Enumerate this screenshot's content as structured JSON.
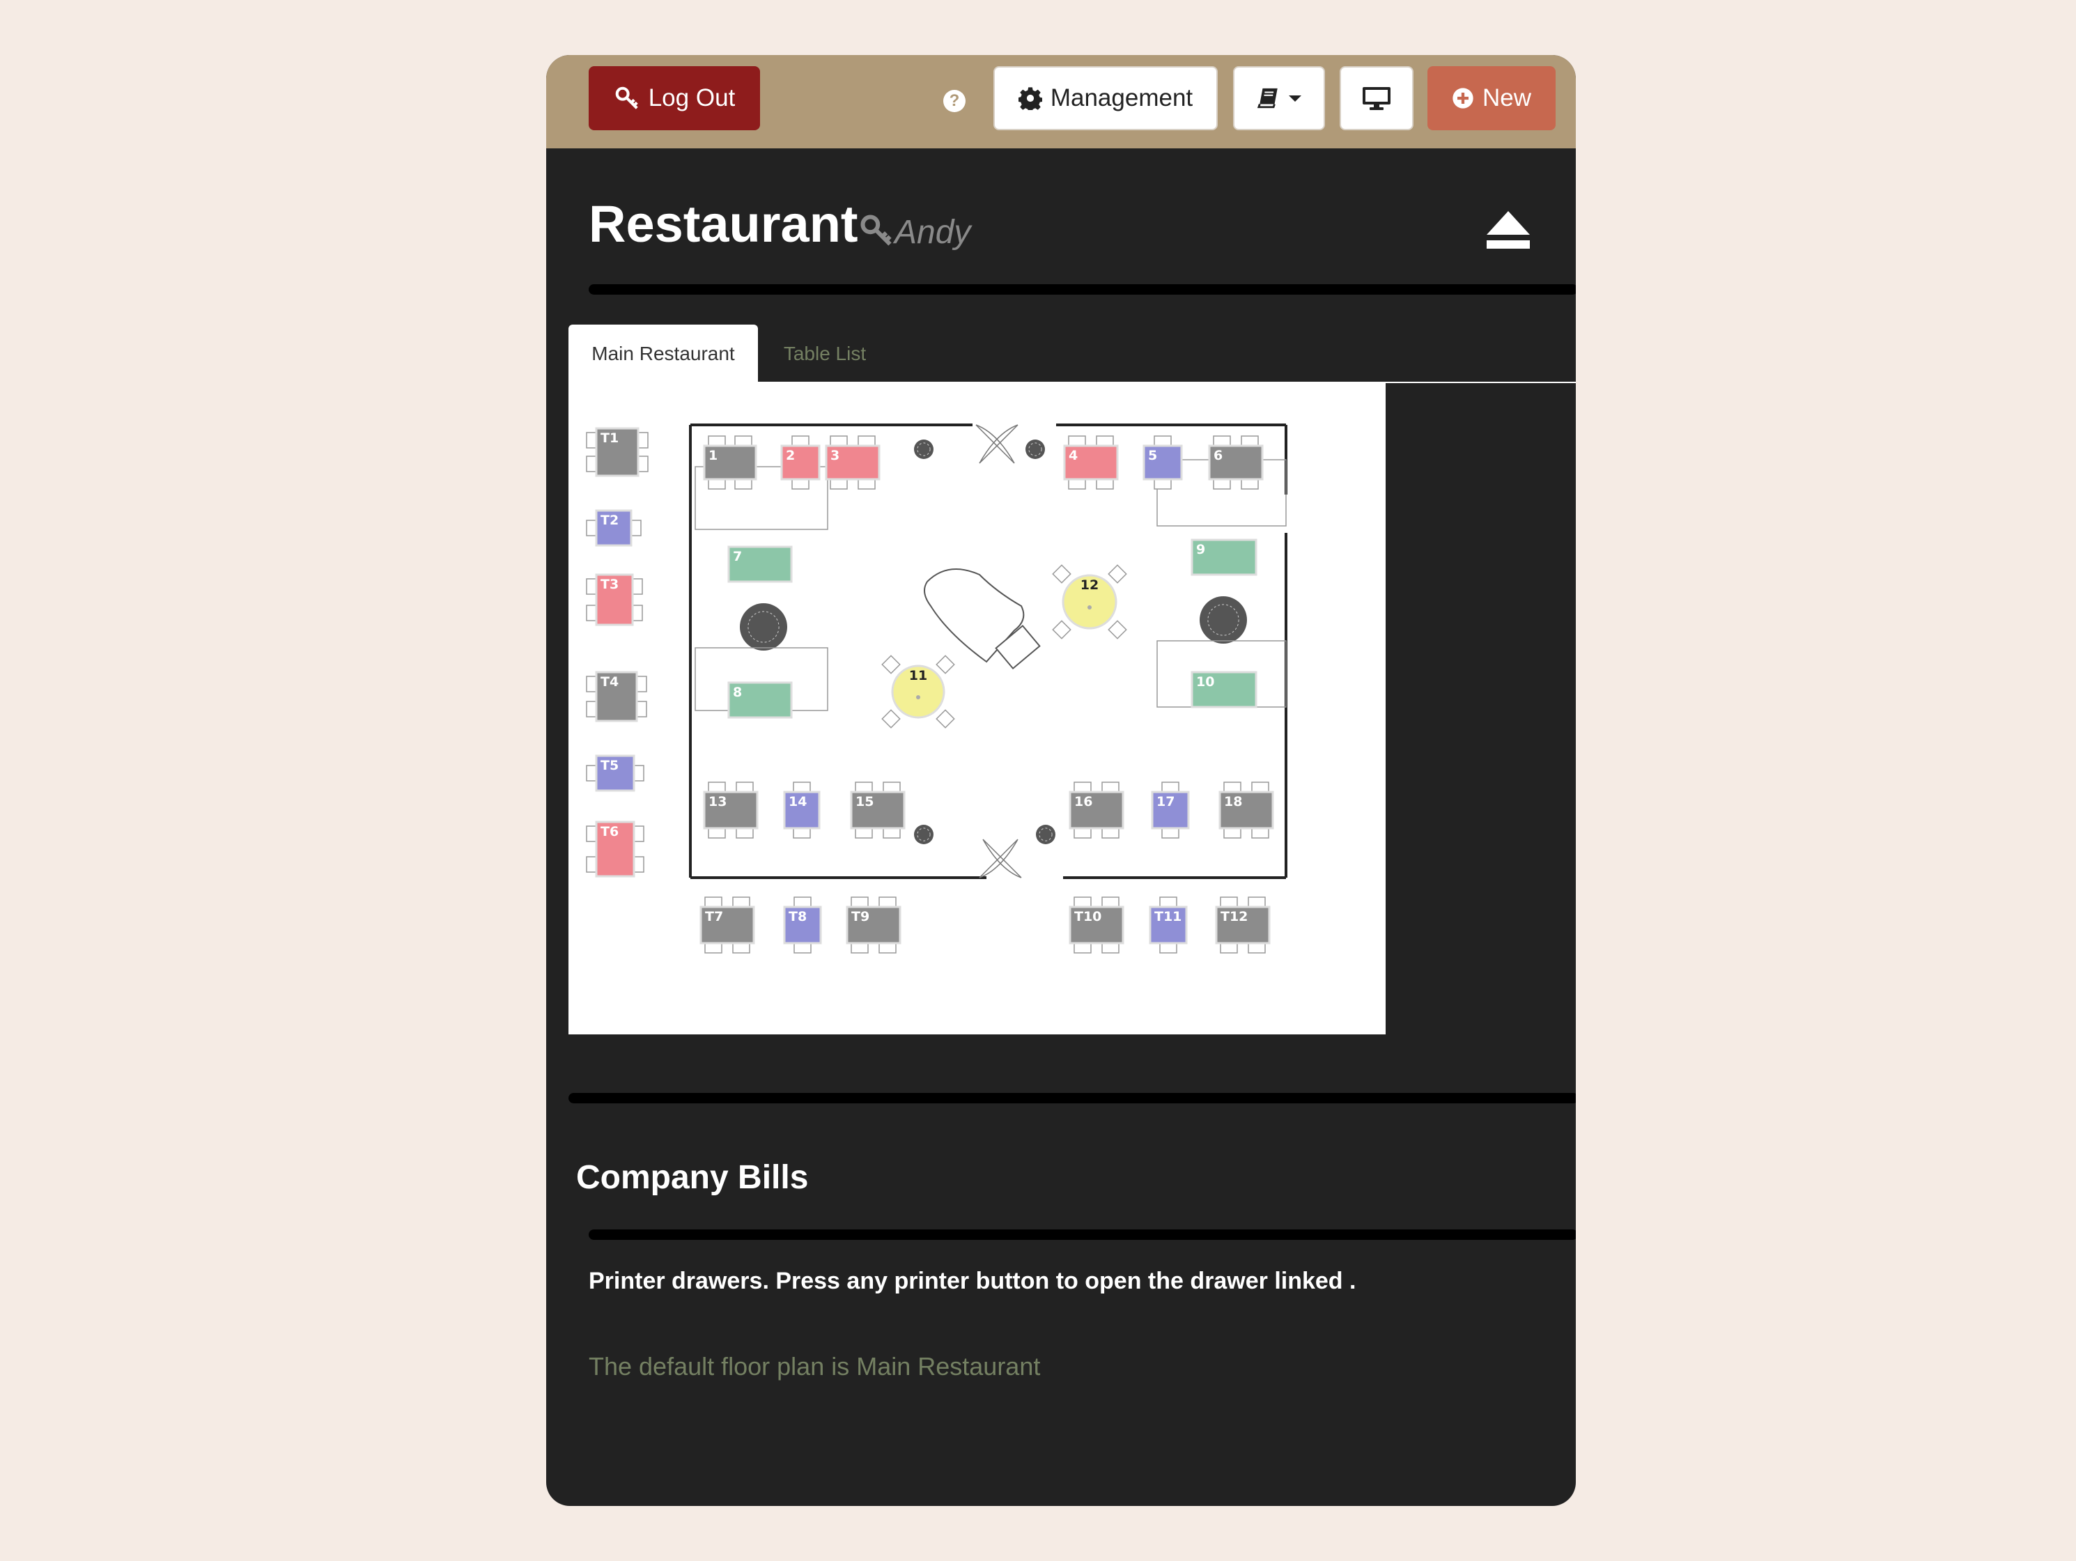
{
  "toolbar": {
    "logout_label": "Log Out",
    "help_label": "?",
    "management_label": "Management",
    "new_label": "New",
    "bar_color": "#b09a78",
    "logout_color": "#8e1c1c",
    "new_color": "#c7684f"
  },
  "header": {
    "title": "Restaurant",
    "user": "Andy"
  },
  "tabs": [
    {
      "label": "Main Restaurant",
      "active": true
    },
    {
      "label": "Table List",
      "active": false
    }
  ],
  "floor_plan": {
    "status_colors": {
      "grey": "#8c8c8c",
      "red": "#f0868f",
      "blue": "#8f8fd6",
      "green": "#8cc6a8",
      "yellow": "#f3f095"
    },
    "tables": [
      {
        "label": "T1",
        "color": "grey"
      },
      {
        "label": "T2",
        "color": "blue"
      },
      {
        "label": "T3",
        "color": "red"
      },
      {
        "label": "T4",
        "color": "grey"
      },
      {
        "label": "T5",
        "color": "blue"
      },
      {
        "label": "T6",
        "color": "red"
      },
      {
        "label": "1",
        "color": "grey"
      },
      {
        "label": "2",
        "color": "red"
      },
      {
        "label": "3",
        "color": "red"
      },
      {
        "label": "4",
        "color": "red"
      },
      {
        "label": "5",
        "color": "blue"
      },
      {
        "label": "6",
        "color": "grey"
      },
      {
        "label": "7",
        "color": "green"
      },
      {
        "label": "8",
        "color": "green"
      },
      {
        "label": "9",
        "color": "green"
      },
      {
        "label": "10",
        "color": "green"
      },
      {
        "label": "11",
        "color": "yellow"
      },
      {
        "label": "12",
        "color": "yellow"
      },
      {
        "label": "13",
        "color": "grey"
      },
      {
        "label": "14",
        "color": "blue"
      },
      {
        "label": "15",
        "color": "grey"
      },
      {
        "label": "16",
        "color": "grey"
      },
      {
        "label": "17",
        "color": "blue"
      },
      {
        "label": "18",
        "color": "grey"
      },
      {
        "label": "T7",
        "color": "grey"
      },
      {
        "label": "T8",
        "color": "blue"
      },
      {
        "label": "T9",
        "color": "grey"
      },
      {
        "label": "T10",
        "color": "grey"
      },
      {
        "label": "T11",
        "color": "blue"
      },
      {
        "label": "T12",
        "color": "grey"
      }
    ]
  },
  "company_bills": {
    "title": "Company Bills",
    "printer_note": "Printer drawers. Press any printer button to open the drawer linked .",
    "default_plan": "The default floor plan is Main Restaurant"
  }
}
